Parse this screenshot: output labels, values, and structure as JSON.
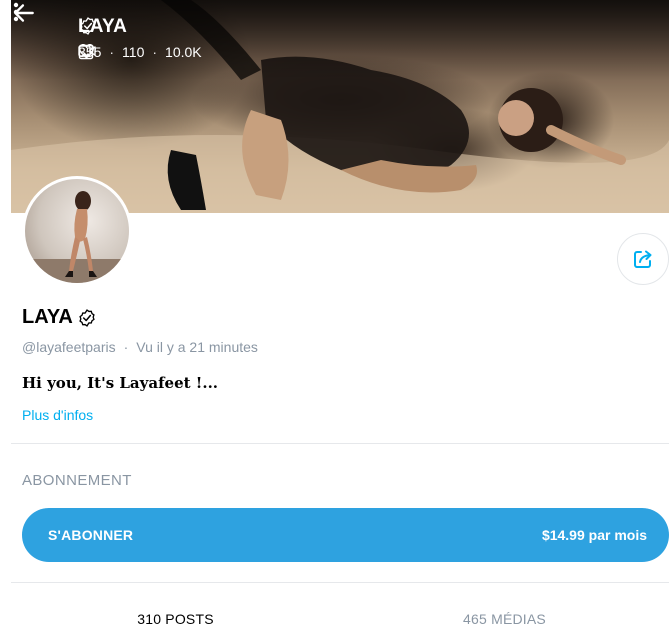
{
  "header": {
    "name": "LAYA",
    "images_count": "355",
    "videos_count": "110",
    "likes_count": "10.0K",
    "separator": "·"
  },
  "profile": {
    "name": "LAYA",
    "handle": "@layafeetparis",
    "separator": "·",
    "last_seen": "Vu  il y a 21 minutes",
    "bio": "Hi you, It's Layafeet !...",
    "more_info": "Plus d'infos"
  },
  "subscription": {
    "section_title": "ABONNEMENT",
    "button_label": "S'ABONNER",
    "price": "$14.99 par mois"
  },
  "tabs": [
    {
      "label": "310 POSTS",
      "active": true
    },
    {
      "label": "465 MÉDIAS",
      "active": false
    }
  ],
  "colors": {
    "accent": "#00aff0",
    "button": "#2ea2e0",
    "muted_text": "#8a96a3"
  },
  "icons": [
    "back-arrow-icon",
    "verified-badge-icon",
    "image-icon",
    "video-icon",
    "heart-icon",
    "more-vertical-icon",
    "share-icon"
  ]
}
